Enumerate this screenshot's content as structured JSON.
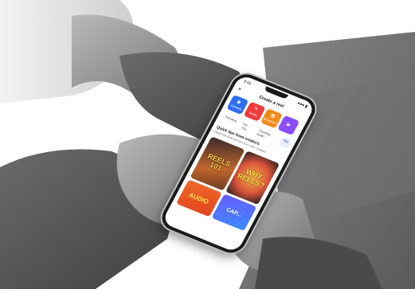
{
  "phone_app": {
    "status_time": "9:41",
    "status_right": "●●● ▮",
    "close_label": "×",
    "title": "Create a reel",
    "tiles": [
      {
        "label": "Camera",
        "icon": "camera-icon",
        "glyph": "◉",
        "color": "#2f6df6"
      },
      {
        "label": "Drafts",
        "icon": "drafts-icon",
        "glyph": "✎",
        "color": "#ef3b3b"
      },
      {
        "label": "Templates",
        "icon": "templates-icon",
        "glyph": "▦",
        "color": "#f28a1b"
      },
      {
        "label": "",
        "icon": "more-icon",
        "glyph": "▶",
        "color": "#8a4dff"
      }
    ],
    "chips": [
      {
        "label": "Trending",
        "active": false
      },
      {
        "label": "For You",
        "active": false
      },
      {
        "label": "Trending audio",
        "active": false
      },
      {
        "label": "Tips",
        "active": true
      }
    ],
    "section_title": "Quick tips from creators",
    "section_subtitle": "Watch the reels and tips from other creators",
    "cards": [
      {
        "label": "REELS 101",
        "style": "reels"
      },
      {
        "label": "WHY REELS?",
        "style": "why"
      },
      {
        "label": "AUDIO",
        "style": "audio"
      },
      {
        "label": "CAP...",
        "style": "cap"
      }
    ]
  }
}
